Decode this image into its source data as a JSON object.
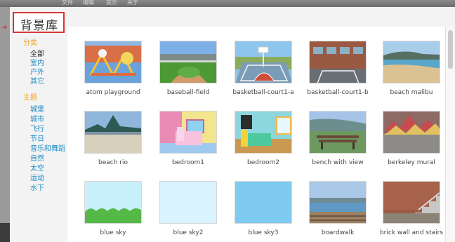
{
  "top_menu": {
    "file": "文件",
    "edit": "编辑",
    "tips": "提示",
    "about": "关于"
  },
  "dialog": {
    "title": "背景库"
  },
  "filters": {
    "category_label": "分类",
    "categories": [
      "全部",
      "室内",
      "户外",
      "其它"
    ],
    "theme_label": "主题",
    "themes": [
      "城堡",
      "城市",
      "飞行",
      "节日",
      "音乐和舞蹈",
      "自然",
      "太空",
      "运动",
      "水下"
    ]
  },
  "tiles": [
    {
      "label": "atom playground"
    },
    {
      "label": "baseball-field"
    },
    {
      "label": "basketball-court1-a"
    },
    {
      "label": "basketball-court1-b"
    },
    {
      "label": "beach malibu"
    },
    {
      "label": "beach rio"
    },
    {
      "label": "bedroom1"
    },
    {
      "label": "bedroom2"
    },
    {
      "label": "bench with view"
    },
    {
      "label": "berkeley mural"
    },
    {
      "label": "blue sky"
    },
    {
      "label": "blue sky2"
    },
    {
      "label": "blue sky3"
    },
    {
      "label": "boardwalk"
    },
    {
      "label": "brick wall and stairs"
    }
  ],
  "colors": {
    "accent_red": "#d53535",
    "heading_orange": "#f0a11a",
    "link_blue": "#1a8ac7"
  }
}
